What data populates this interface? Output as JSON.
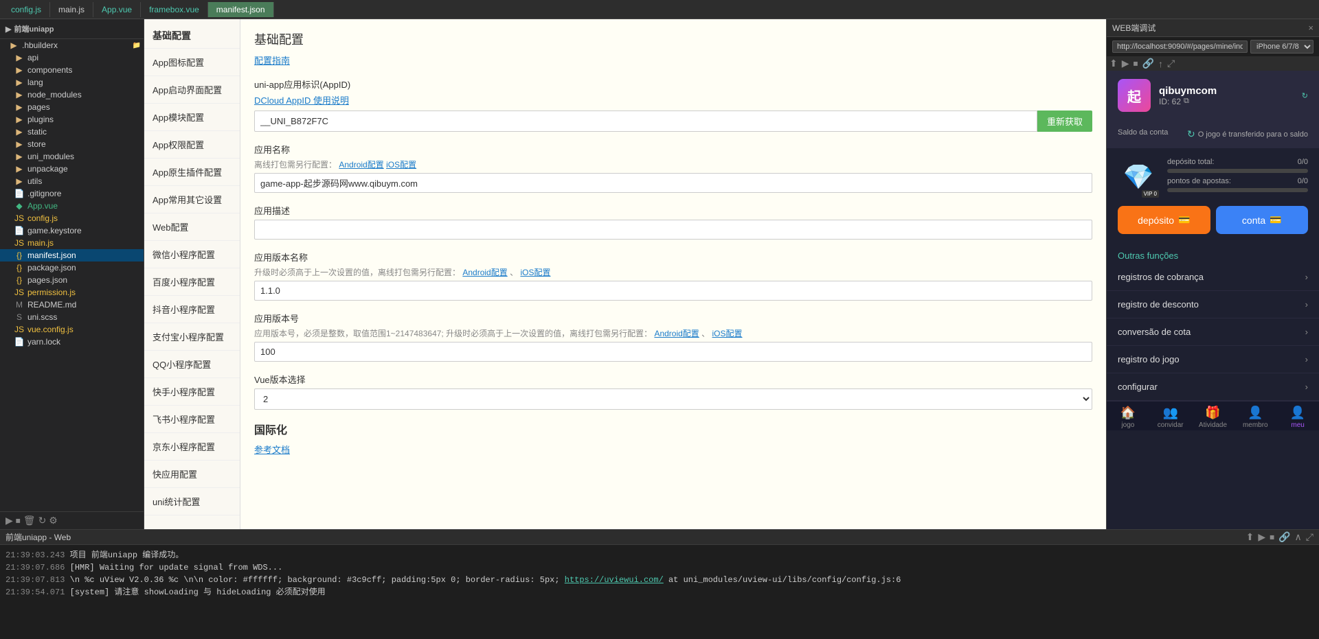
{
  "tabs": [
    {
      "id": "config-js",
      "label": "config.js",
      "active": false,
      "color": "teal"
    },
    {
      "id": "main-js",
      "label": "main.js",
      "active": false,
      "color": "normal"
    },
    {
      "id": "app-vue",
      "label": "App.vue",
      "active": false,
      "color": "teal"
    },
    {
      "id": "framebox-vue",
      "label": "framebox.vue",
      "active": false,
      "color": "teal"
    },
    {
      "id": "manifest-json",
      "label": "manifest.json",
      "active": true,
      "color": "green"
    }
  ],
  "sidebar": {
    "project_name": "前端uniapp",
    "items": [
      {
        "type": "folder",
        "label": ".hbuilderx",
        "indent": 1,
        "expanded": true,
        "hasChildren": true,
        "icon": "folder"
      },
      {
        "type": "folder",
        "label": "api",
        "indent": 2,
        "hasChildren": true,
        "icon": "folder"
      },
      {
        "type": "folder",
        "label": "components",
        "indent": 2,
        "hasChildren": true,
        "icon": "folder"
      },
      {
        "type": "folder",
        "label": "lang",
        "indent": 2,
        "hasChildren": true,
        "icon": "folder"
      },
      {
        "type": "folder",
        "label": "node_modules",
        "indent": 2,
        "hasChildren": true,
        "icon": "folder"
      },
      {
        "type": "folder",
        "label": "pages",
        "indent": 2,
        "hasChildren": true,
        "icon": "folder"
      },
      {
        "type": "folder",
        "label": "plugins",
        "indent": 2,
        "hasChildren": true,
        "icon": "folder"
      },
      {
        "type": "folder",
        "label": "static",
        "indent": 2,
        "hasChildren": true,
        "icon": "folder"
      },
      {
        "type": "folder",
        "label": "store",
        "indent": 2,
        "hasChildren": true,
        "icon": "folder"
      },
      {
        "type": "folder",
        "label": "uni_modules",
        "indent": 2,
        "hasChildren": true,
        "icon": "folder"
      },
      {
        "type": "folder",
        "label": "unpackage",
        "indent": 2,
        "hasChildren": true,
        "icon": "folder"
      },
      {
        "type": "folder",
        "label": "utils",
        "indent": 2,
        "hasChildren": true,
        "icon": "folder"
      },
      {
        "type": "file",
        "label": ".gitignore",
        "indent": 2,
        "icon": "file"
      },
      {
        "type": "file",
        "label": "App.vue",
        "indent": 2,
        "icon": "vue"
      },
      {
        "type": "file",
        "label": "config.js",
        "indent": 2,
        "icon": "js"
      },
      {
        "type": "file",
        "label": "game.keystore",
        "indent": 2,
        "icon": "file"
      },
      {
        "type": "file",
        "label": "main.js",
        "indent": 2,
        "icon": "js"
      },
      {
        "type": "file",
        "label": "manifest.json",
        "indent": 2,
        "icon": "json",
        "selected": true
      },
      {
        "type": "file",
        "label": "package.json",
        "indent": 2,
        "icon": "json"
      },
      {
        "type": "file",
        "label": "pages.json",
        "indent": 2,
        "icon": "json"
      },
      {
        "type": "file",
        "label": "permission.js",
        "indent": 2,
        "icon": "js"
      },
      {
        "type": "file",
        "label": "README.md",
        "indent": 2,
        "icon": "file"
      },
      {
        "type": "file",
        "label": "uni.scss",
        "indent": 2,
        "icon": "file"
      },
      {
        "type": "file",
        "label": "vue.config.js",
        "indent": 2,
        "icon": "js"
      },
      {
        "type": "file",
        "label": "yarn.lock",
        "indent": 2,
        "icon": "file"
      }
    ]
  },
  "config_nav": [
    {
      "id": "basic",
      "label": "基础配置",
      "isSection": true
    },
    {
      "id": "app-icon",
      "label": "App图标配置"
    },
    {
      "id": "app-splash",
      "label": "App启动界面配置"
    },
    {
      "id": "app-module",
      "label": "App模块配置"
    },
    {
      "id": "app-permission",
      "label": "App权限配置"
    },
    {
      "id": "app-native",
      "label": "App原生插件配置"
    },
    {
      "id": "app-other",
      "label": "App常用其它设置"
    },
    {
      "id": "web",
      "label": "Web配置"
    },
    {
      "id": "weixin",
      "label": "微信小程序配置"
    },
    {
      "id": "baidu",
      "label": "百度小程序配置"
    },
    {
      "id": "tiktok",
      "label": "抖音小程序配置"
    },
    {
      "id": "alipay",
      "label": "支付宝小程序配置"
    },
    {
      "id": "qq",
      "label": "QQ小程序配置"
    },
    {
      "id": "kuaishou",
      "label": "快手小程序配置"
    },
    {
      "id": "feishu",
      "label": "飞书小程序配置"
    },
    {
      "id": "jingdong",
      "label": "京东小程序配置"
    },
    {
      "id": "quick",
      "label": "快应用配置"
    },
    {
      "id": "uni-stat",
      "label": "uni统计配置"
    }
  ],
  "config_content": {
    "title": "基础配置",
    "link": "配置指南",
    "appid_label": "uni-app应用标识(AppID)",
    "appid_link_dcloud": "DCloud AppID 使用说明",
    "appid_value": "__UNI_B872F7C",
    "appid_btn": "重新获取",
    "appname_label": "应用名称",
    "appname_hint": "离线打包需另行配置：",
    "appname_hint_android": "Android配置",
    "appname_hint_ios": "iOS配置",
    "appname_value": "game-app-起步源码网www.qibuym.com",
    "description_label": "应用描述",
    "description_value": "",
    "version_name_label": "应用版本名称",
    "version_name_hint": "升级时必须高于上一次设置的值，离线打包需另行配置：",
    "version_name_android": "Android配置",
    "version_name_ios": "iOS配置",
    "version_name_value": "1.1.0",
    "version_num_label": "应用版本号",
    "version_num_hint": "应用版本号，必须是整数，取值范围1~2147483647; 升级时必须高于上一次设置的值，离线打包需另行配置：",
    "version_num_android": "Android配置",
    "version_num_ios": "iOS配置",
    "version_num_value": "100",
    "vue_label": "Vue版本选择",
    "vue_value": "2",
    "i18n_title": "国际化",
    "i18n_link": "参考文档"
  },
  "preview": {
    "tab_title": "WEB端调试",
    "close_label": "×",
    "url": "http://localhost:9090/#/pages/mine/index",
    "device": "iPhone 6/7/8",
    "user": {
      "avatar_letter": "起",
      "username": "qibuymcom",
      "id": "ID: 62",
      "balance_label": "Saldo da conta",
      "transfer_label": "O jogo é transferido para o saldo",
      "deposit_total_label": "depósito total:",
      "deposit_total_value": "0/0",
      "bet_points_label": "pontos de apostas:",
      "bet_points_value": "0/0"
    },
    "vip": {
      "label": "VIP 0",
      "deposit_total": "0/0",
      "bet_points": "0/0"
    },
    "buttons": {
      "deposit": "depósito",
      "account": "conta"
    },
    "outras_label": "Outras funções",
    "menu_items": [
      "registros de cobrança",
      "registro de desconto",
      "conversão de cota",
      "registro do jogo",
      "configurar"
    ],
    "bottom_nav": [
      {
        "label": "jogo",
        "icon": "🏠",
        "active": false
      },
      {
        "label": "convidar",
        "icon": "👥",
        "active": false
      },
      {
        "label": "Atividade",
        "icon": "🎁",
        "active": false
      },
      {
        "label": "membro",
        "icon": "👤",
        "active": false
      },
      {
        "label": "meu",
        "icon": "👤",
        "active": true
      }
    ]
  },
  "terminal": {
    "title": "前端uniapp - Web",
    "logs": [
      {
        "time": "21:39:03.243",
        "text": "项目 前端uniapp 编译成功。",
        "type": "info"
      },
      {
        "time": "21:39:07.686",
        "text": "[HMR] Waiting for update signal from WDS...",
        "type": "info"
      },
      {
        "time": "21:39:07.813",
        "text": "\\n %c uView V2.0.36 %c \\n\\n color: #ffffff; background: #3c9cff; padding:5px 0; border-radius: 5px;",
        "link": "https://uviewui.com/",
        "link_text": "https://uviewui.com/",
        "suffix": " at uni_modules/uview-ui/libs/config/config.js:6",
        "type": "link"
      },
      {
        "time": "21:39:54.071",
        "text": "[system] 请注意 showLoading 与 hideLoading 必须配对使用",
        "type": "info"
      }
    ]
  }
}
